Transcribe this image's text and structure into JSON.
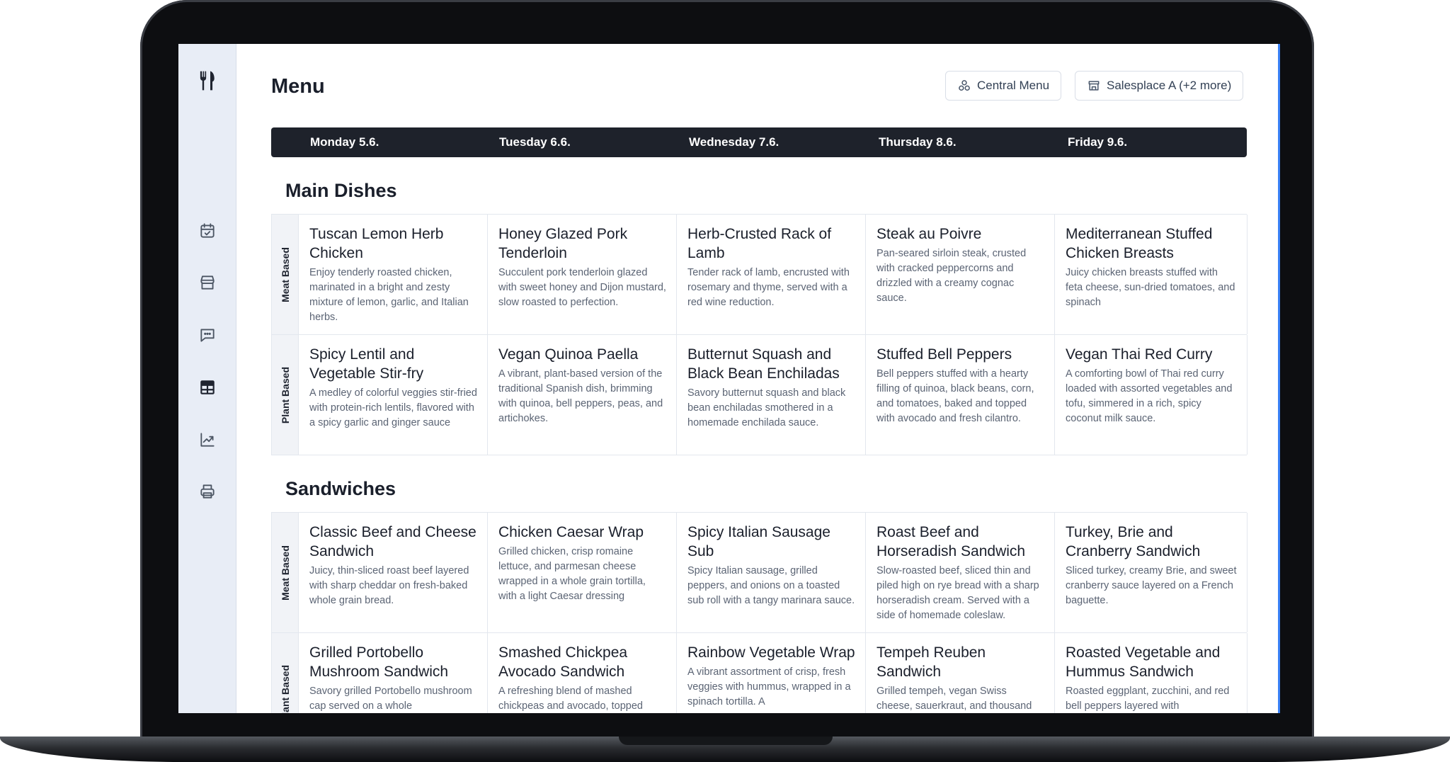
{
  "page": {
    "title": "Menu"
  },
  "header": {
    "central_menu_label": "Central Menu",
    "salesplace_label": "Salesplace A (+2 more)"
  },
  "days": [
    "Monday 5.6.",
    "Tuesday 6.6.",
    "Wednesday 7.6.",
    "Thursday 8.6.",
    "Friday 9.6."
  ],
  "sections": [
    {
      "title": "Main Dishes",
      "rows": [
        {
          "label": "Meat Based",
          "dishes": [
            {
              "name": "Tuscan Lemon Herb Chicken",
              "desc": "Enjoy tenderly roasted chicken, marinated in a bright and zesty mixture of lemon, garlic, and Italian herbs."
            },
            {
              "name": "Honey Glazed Pork Tenderloin",
              "desc": "Succulent pork tenderloin glazed with sweet honey and Dijon mustard, slow roasted to perfection."
            },
            {
              "name": "Herb-Crusted Rack of Lamb",
              "desc": "Tender rack of lamb, encrusted with rosemary and thyme, served with a red wine reduction."
            },
            {
              "name": "Steak au Poivre",
              "desc": "Pan-seared sirloin steak, crusted with cracked peppercorns and drizzled with a creamy cognac sauce."
            },
            {
              "name": "Mediterranean Stuffed Chicken Breasts",
              "desc": "Juicy chicken breasts stuffed with feta cheese, sun-dried tomatoes, and spinach"
            }
          ]
        },
        {
          "label": "Plant Based",
          "dishes": [
            {
              "name": "Spicy Lentil and Vegetable Stir-fry",
              "desc": "A medley of colorful veggies stir-fried with protein-rich lentils, flavored with a spicy garlic and ginger sauce"
            },
            {
              "name": "Vegan Quinoa Paella",
              "desc": "A vibrant, plant-based version of the traditional Spanish dish, brimming with quinoa, bell peppers, peas, and artichokes."
            },
            {
              "name": "Butternut Squash and Black Bean Enchiladas",
              "desc": "Savory butternut squash and black bean enchiladas smothered in a homemade enchilada sauce."
            },
            {
              "name": "Stuffed Bell Peppers",
              "desc": "Bell peppers stuffed with a hearty filling of quinoa, black beans, corn, and tomatoes, baked and topped with avocado and fresh cilantro."
            },
            {
              "name": "Vegan Thai Red Curry",
              "desc": "A comforting bowl of Thai red curry loaded with assorted vegetables and tofu, simmered in a rich, spicy coconut milk sauce."
            }
          ]
        }
      ]
    },
    {
      "title": "Sandwiches",
      "rows": [
        {
          "label": "Meat Based",
          "dishes": [
            {
              "name": "Classic Beef and Cheese Sandwich",
              "desc": "Juicy, thin-sliced roast beef layered with sharp cheddar on fresh-baked whole grain bread."
            },
            {
              "name": "Chicken Caesar Wrap",
              "desc": "Grilled chicken, crisp romaine lettuce, and parmesan cheese wrapped in a whole grain tortilla, with a light Caesar dressing"
            },
            {
              "name": "Spicy Italian Sausage Sub",
              "desc": "Spicy Italian sausage, grilled peppers, and onions on a toasted sub roll with a tangy marinara sauce."
            },
            {
              "name": "Roast Beef and Horseradish Sandwich",
              "desc": "Slow-roasted beef, sliced thin and piled high on rye bread with a sharp horseradish cream. Served with a side of homemade coleslaw."
            },
            {
              "name": "Turkey, Brie and Cranberry Sandwich",
              "desc": "Sliced turkey, creamy Brie, and sweet cranberry sauce layered on a French baguette."
            }
          ]
        },
        {
          "label": "Plant Based",
          "dishes": [
            {
              "name": "Grilled Portobello Mushroom Sandwich",
              "desc": "Savory grilled Portobello mushroom cap served on a whole"
            },
            {
              "name": "Smashed Chickpea Avocado Sandwich",
              "desc": "A refreshing blend of mashed chickpeas and avocado, topped"
            },
            {
              "name": "Rainbow Vegetable Wrap",
              "desc": "A vibrant assortment of crisp, fresh veggies with hummus, wrapped in a spinach tortilla. A"
            },
            {
              "name": "Tempeh Reuben Sandwich",
              "desc": "Grilled tempeh, vegan Swiss cheese, sauerkraut, and thousand"
            },
            {
              "name": "Roasted Vegetable and Hummus Sandwich",
              "desc": "Roasted eggplant, zucchini, and red bell peppers layered with"
            }
          ]
        }
      ]
    }
  ],
  "colors": {
    "accent": "#3b82f6",
    "day_bar": "#1e222b",
    "sidebar": "#e8edf6"
  }
}
